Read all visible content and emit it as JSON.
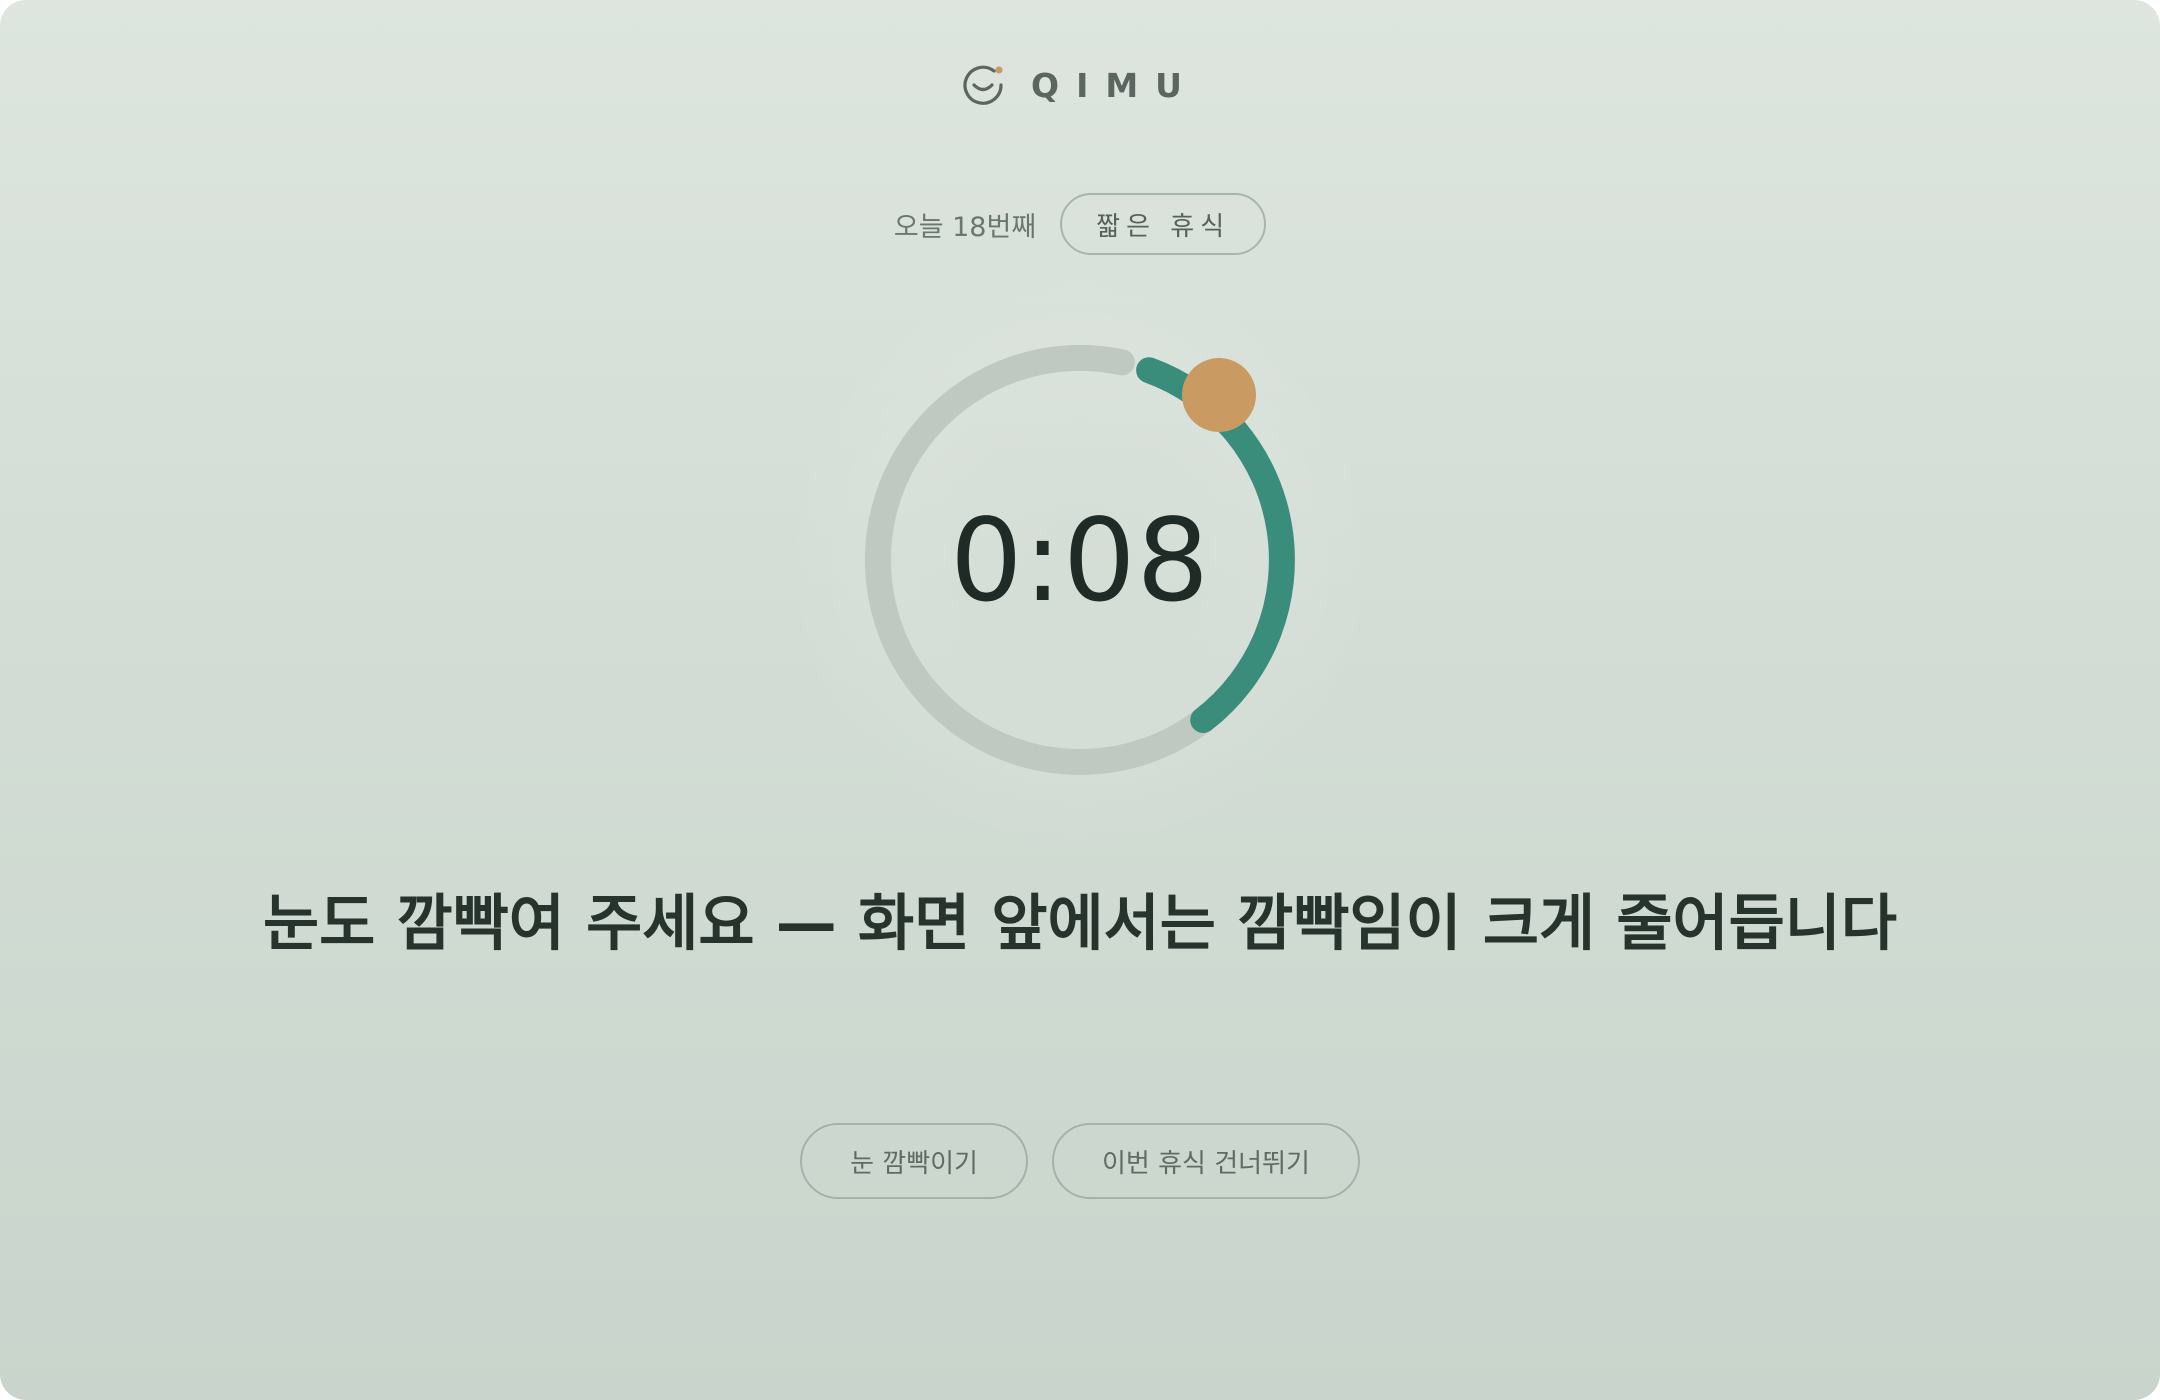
{
  "brand": {
    "name": "QIMU",
    "icon": "smile-logo-icon",
    "accent_dot_color": "#c99b63"
  },
  "session": {
    "count_label": "오늘 18번째",
    "break_type": "짧은 휴식"
  },
  "timer": {
    "display": "0:08",
    "progress_fraction": 0.45,
    "track_color": "#bfc9c2",
    "progress_color": "#3b8d7b",
    "marker_color": "#c99b63"
  },
  "message": "눈도 깜빡여 주세요 — 화면 앞에서는 깜빡임이 크게 줄어듭니다",
  "actions": {
    "blink_label": "눈 깜빡이기",
    "skip_label": "이번 휴식 건너뛰기"
  }
}
